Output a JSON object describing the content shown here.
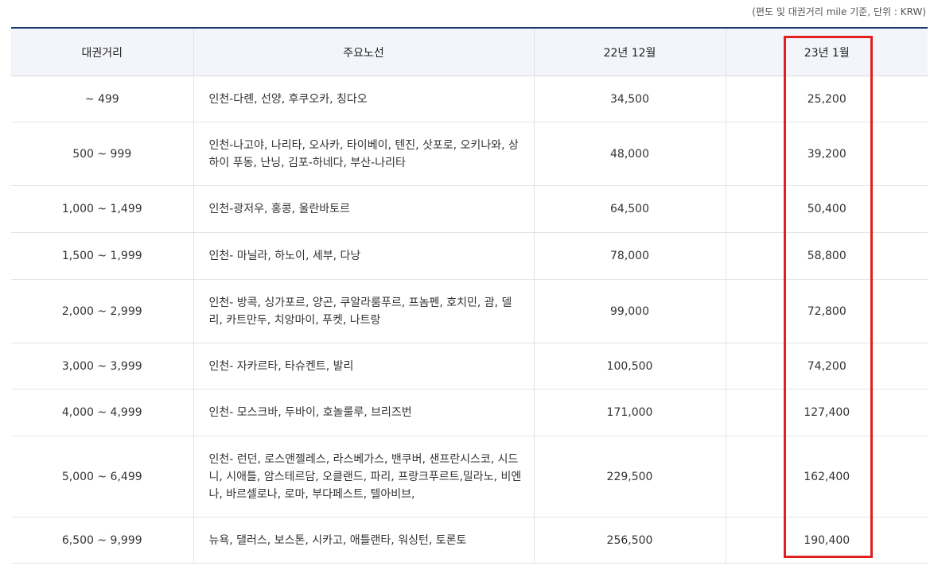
{
  "unit_note": "(편도 및 대권거리 mile 기준, 단위 : KRW)",
  "headers": [
    "대권거리",
    "주요노선",
    "22년 12월",
    "23년 1월"
  ],
  "rows": [
    {
      "distance": "~ 499",
      "routes": "인천-다롄, 선양, 후쿠오카, 칭다오",
      "dec22": "34,500",
      "jan23": "25,200"
    },
    {
      "distance": "500 ~ 999",
      "routes": "인천-나고야, 나리타, 오사카, 타이베이, 텐진, 삿포로, 오키나와, 상하이 푸동, 난닝, 김포-하네다, 부산-나리타",
      "dec22": "48,000",
      "jan23": "39,200"
    },
    {
      "distance": "1,000 ~ 1,499",
      "routes": "인천-광저우, 홍콩, 울란바토르",
      "dec22": "64,500",
      "jan23": "50,400"
    },
    {
      "distance": "1,500 ~ 1,999",
      "routes": "인천- 마닐라, 하노이, 세부, 다낭",
      "dec22": "78,000",
      "jan23": "58,800"
    },
    {
      "distance": "2,000 ~ 2,999",
      "routes": "인천- 방콕, 싱가포르, 양곤, 쿠알라룸푸르, 프놈펜, 호치민, 괌, 델리, 카트만두, 치앙마이, 푸켓, 나트랑",
      "dec22": "99,000",
      "jan23": "72,800"
    },
    {
      "distance": "3,000 ~ 3,999",
      "routes": "인천- 자카르타, 타슈켄트, 발리",
      "dec22": "100,500",
      "jan23": "74,200"
    },
    {
      "distance": "4,000 ~ 4,999",
      "routes": "인천- 모스크바, 두바이, 호놀룰루, 브리즈번",
      "dec22": "171,000",
      "jan23": "127,400"
    },
    {
      "distance": "5,000 ~ 6,499",
      "routes": "인천- 런던, 로스앤젤레스, 라스베가스, 밴쿠버, 샌프란시스코, 시드니, 시애틀, 암스테르담, 오클랜드, 파리, 프랑크푸르트,밀라노, 비엔나, 바르셀로나, 로마, 부다페스트, 텔아비브,",
      "dec22": "229,500",
      "jan23": "162,400"
    },
    {
      "distance": "6,500 ~ 9,999",
      "routes": "뉴욕, 댈러스, 보스톤, 시카고, 애틀랜타, 워싱턴, 토론토",
      "dec22": "256,500",
      "jan23": "190,400"
    }
  ],
  "colors": {
    "header_border": "#1f3b6e",
    "header_bg": "#f3f5fa",
    "highlight": "#e02020"
  }
}
